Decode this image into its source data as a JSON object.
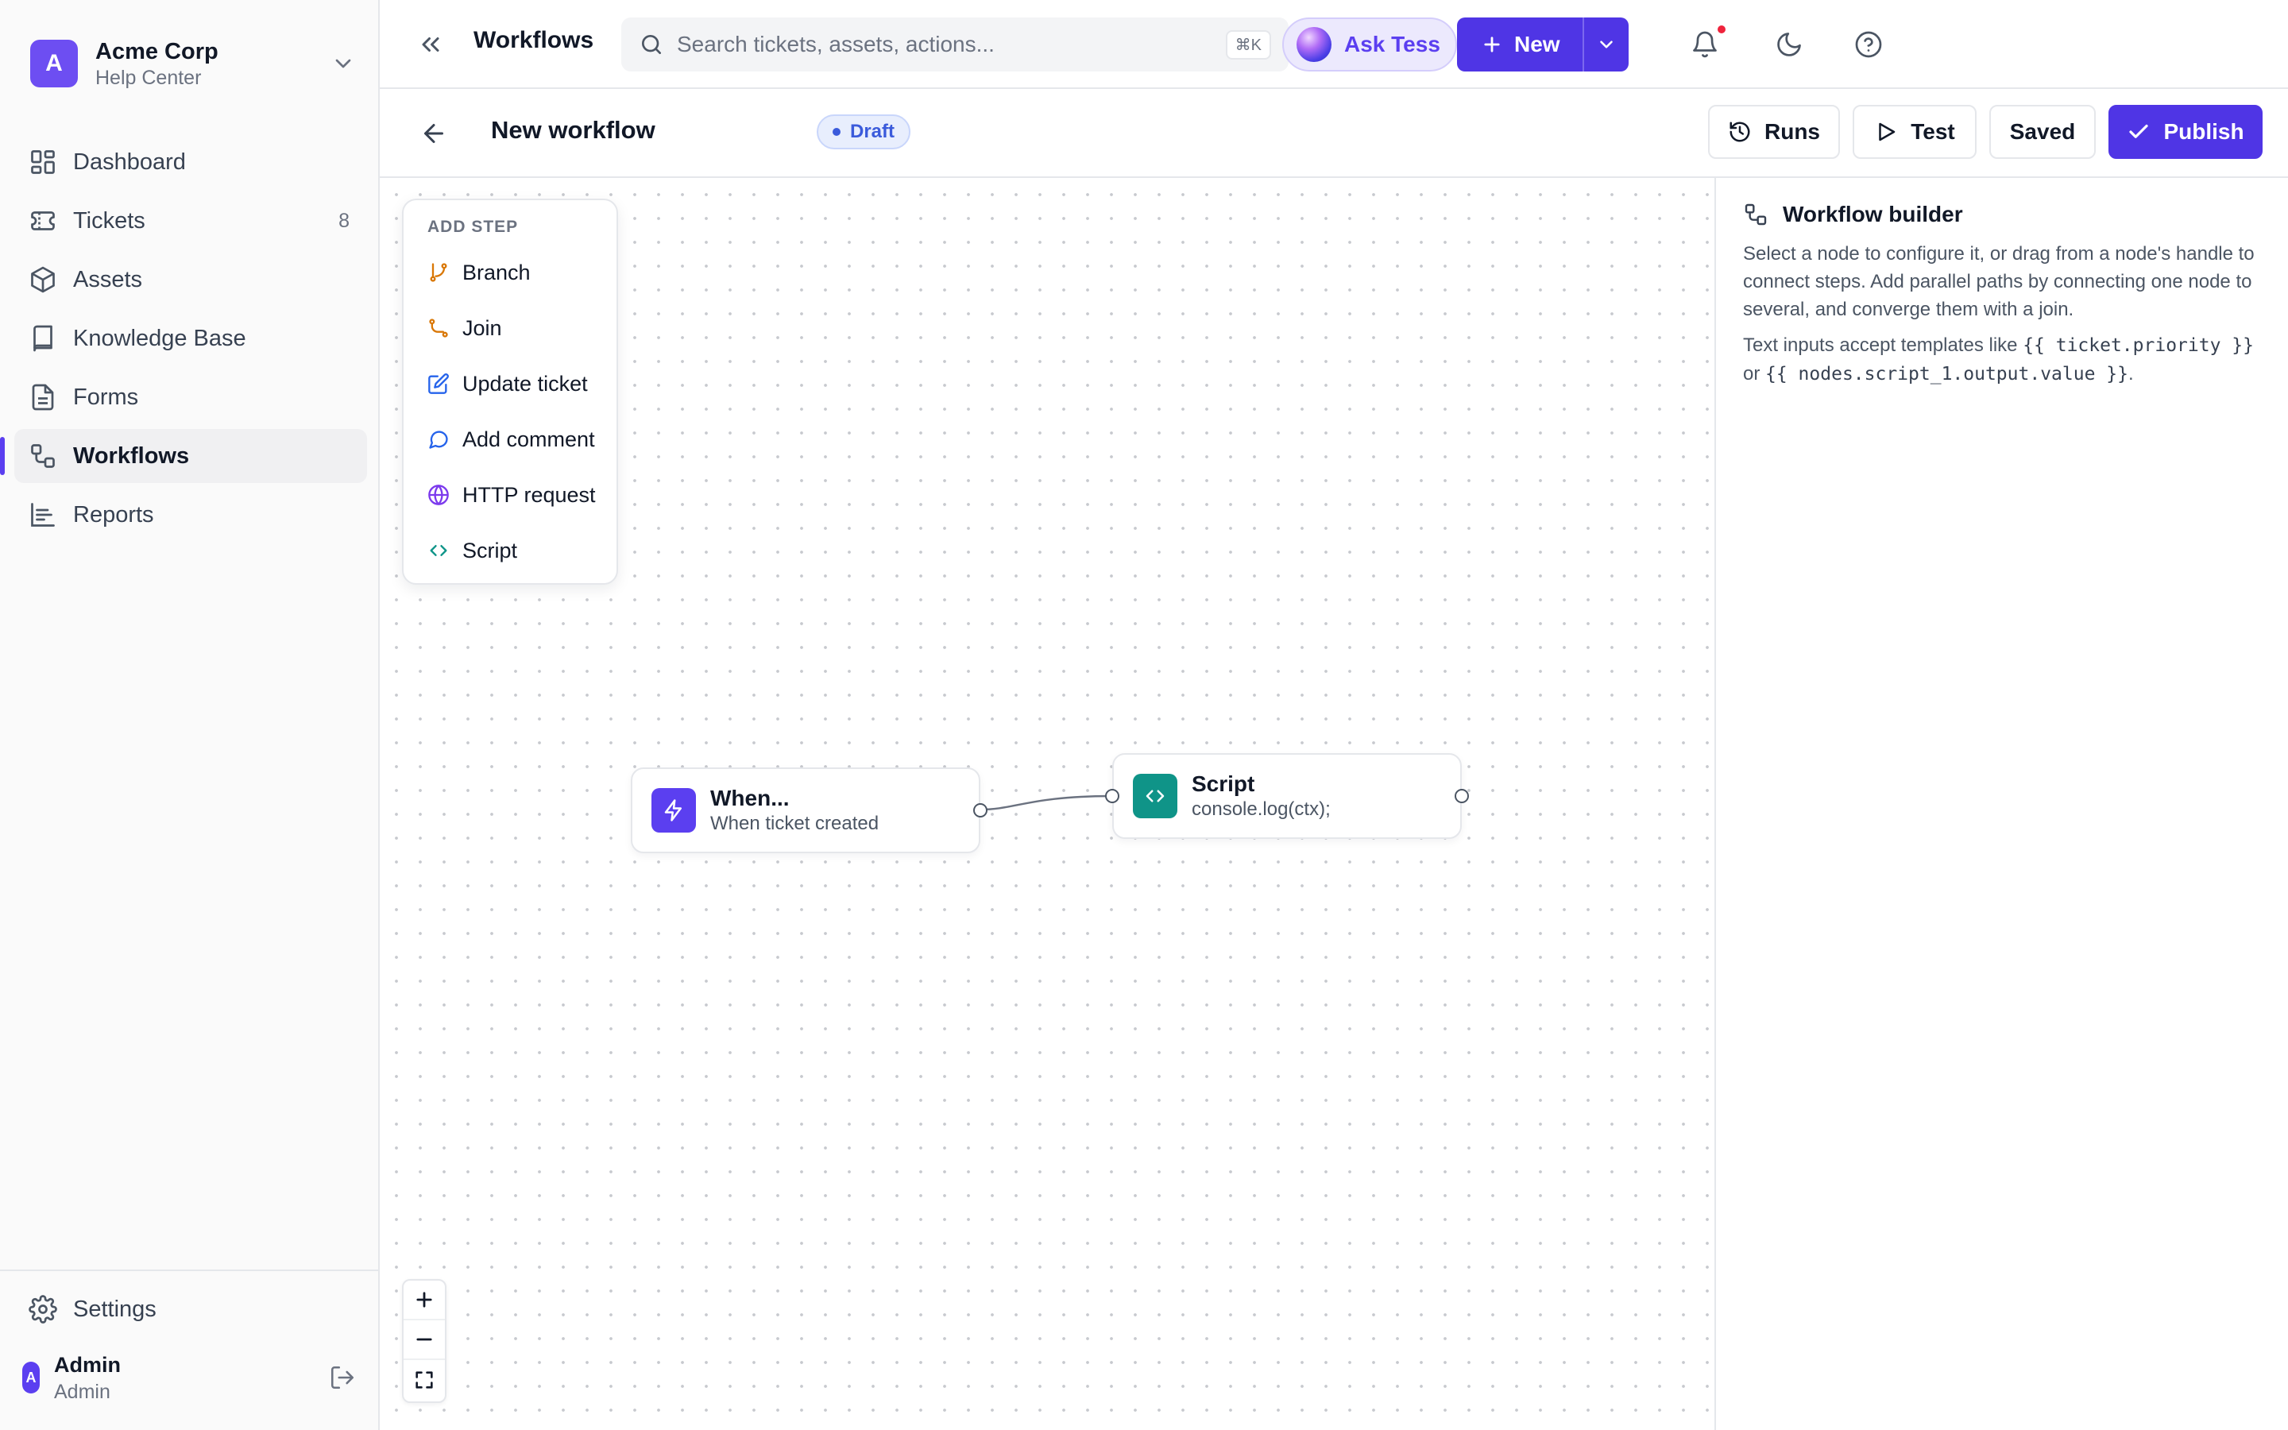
{
  "org": {
    "initial": "A",
    "name": "Acme Corp",
    "subtitle": "Help Center"
  },
  "nav": {
    "items": [
      {
        "label": "Dashboard",
        "icon": "dashboard-icon"
      },
      {
        "label": "Tickets",
        "icon": "ticket-icon",
        "count": "8"
      },
      {
        "label": "Assets",
        "icon": "box-icon"
      },
      {
        "label": "Knowledge Base",
        "icon": "book-icon"
      },
      {
        "label": "Forms",
        "icon": "file-icon"
      },
      {
        "label": "Workflows",
        "icon": "workflow-icon",
        "active": true
      },
      {
        "label": "Reports",
        "icon": "chart-icon"
      }
    ],
    "settings_label": "Settings"
  },
  "user": {
    "initial": "A",
    "name": "Admin",
    "role": "Admin"
  },
  "topbar": {
    "title": "Workflows",
    "search_placeholder": "Search tickets, assets, actions...",
    "search_shortcut": "⌘K",
    "ask_label": "Ask Tess",
    "new_label": "New"
  },
  "workflow": {
    "title": "New workflow",
    "status": "Draft",
    "runs_label": "Runs",
    "test_label": "Test",
    "saved_label": "Saved",
    "publish_label": "Publish"
  },
  "add_step": {
    "title": "ADD STEP",
    "items": [
      {
        "label": "Branch",
        "icon": "branch-icon",
        "color": "#d97706"
      },
      {
        "label": "Join",
        "icon": "join-icon",
        "color": "#d97706"
      },
      {
        "label": "Update ticket",
        "icon": "edit-icon",
        "color": "#2563eb"
      },
      {
        "label": "Add comment",
        "icon": "comment-icon",
        "color": "#2563eb"
      },
      {
        "label": "HTTP request",
        "icon": "globe-icon",
        "color": "#7c3aed"
      },
      {
        "label": "Script",
        "icon": "code-icon",
        "color": "#0d9488"
      }
    ]
  },
  "nodes": {
    "trigger": {
      "title": "When...",
      "subtitle": "When ticket created",
      "icon": "lightning-icon",
      "color": "#5b3ff0"
    },
    "script": {
      "title": "Script",
      "subtitle": "console.log(ctx);",
      "icon": "code-icon",
      "color": "#0f9488"
    }
  },
  "zoom": {
    "in": "zoom-in-icon",
    "out": "zoom-out-icon",
    "fit": "fit-view-icon"
  },
  "panel": {
    "title": "Workflow builder",
    "description": "Select a node to configure it, or drag from a node's handle to connect steps. Add parallel paths by connecting one node to several, and converge them with a join.",
    "templates_prefix": "Text inputs accept templates like",
    "template_1": "{{ ticket.priority }}",
    "templates_or": "or",
    "template_2": "{{ nodes.script_1.output.value }}",
    "templates_suffix": "."
  },
  "colors": {
    "accent": "#4f35e5",
    "draft": "#3b5bdb",
    "notification": "#ef233c"
  }
}
